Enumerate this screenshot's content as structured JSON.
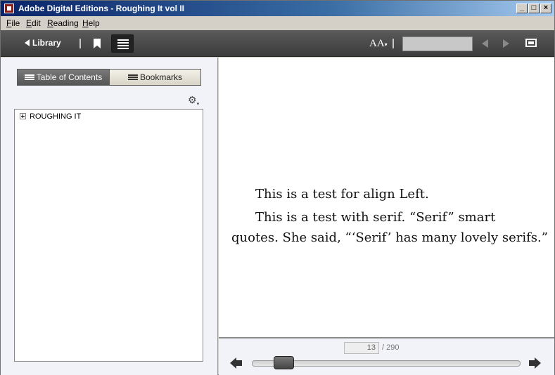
{
  "window": {
    "title": "Adobe Digital Editions - Roughing It vol II",
    "minimize": "_",
    "maximize": "□",
    "close": "×"
  },
  "menu": [
    "File",
    "Edit",
    "Reading",
    "Help"
  ],
  "toolbar": {
    "library_label": "Library",
    "font_size_label": "AA",
    "font_size_icon": "text-size-icon",
    "search_placeholder": ""
  },
  "sidebar": {
    "tabs": [
      {
        "label": "Table of Contents",
        "active": true
      },
      {
        "label": "Bookmarks",
        "active": false
      }
    ],
    "toc_items": [
      {
        "label": "ROUGHING IT",
        "expandable": true
      }
    ]
  },
  "content": {
    "paragraphs": [
      "This is a test for align Left.",
      "This is a test with serif. “Serif” smart",
      "quotes. She said, “‘Serif’ has many lovely serifs.”"
    ]
  },
  "navigation": {
    "current_page": "13",
    "total_pages": "/ 290",
    "progress_fraction": 0.045
  },
  "colors": {
    "titlebar_start": "#0a246a",
    "toolbar_bg": "#4a4a4a",
    "panel_bg": "#f1f3f8"
  }
}
